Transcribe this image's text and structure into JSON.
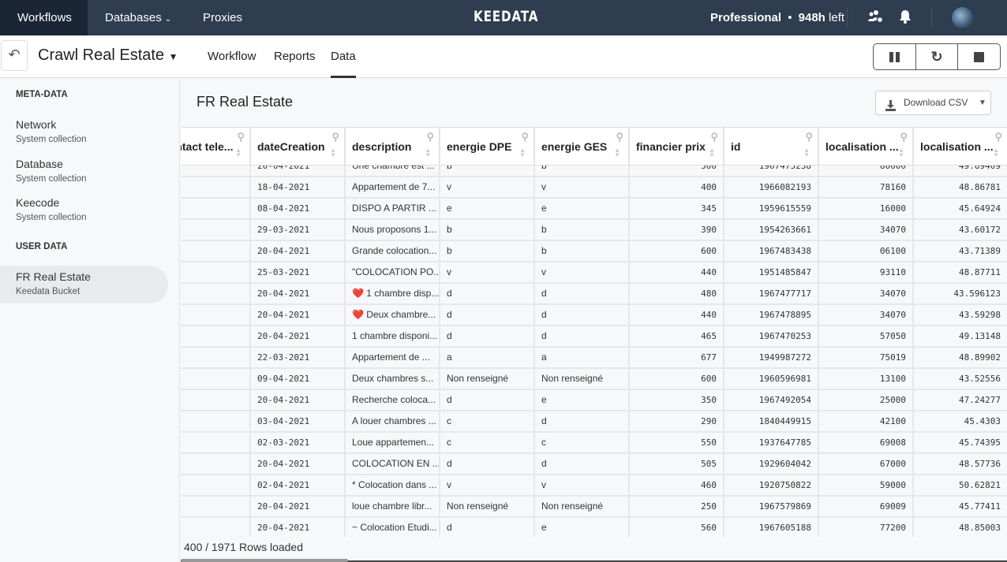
{
  "topnav": {
    "items": [
      "Workflows",
      "Databases",
      "Proxies"
    ],
    "logo": "KEEDATA",
    "plan": "Professional",
    "bullet": "•",
    "hours": "948h",
    "left": "left"
  },
  "subheader": {
    "title": "Crawl Real Estate",
    "tabs": [
      "Workflow",
      "Reports",
      "Data"
    ],
    "active_tab": "Data"
  },
  "sidebar": {
    "meta_label": "META-DATA",
    "meta_items": [
      {
        "name": "Network",
        "sub": "System collection"
      },
      {
        "name": "Database",
        "sub": "System collection"
      },
      {
        "name": "Keecode",
        "sub": "System collection"
      }
    ],
    "user_label": "USER DATA",
    "user_items": [
      {
        "name": "FR Real Estate",
        "sub": "Keedata Bucket"
      }
    ]
  },
  "main": {
    "title": "FR Real Estate",
    "download_label": "Download CSV"
  },
  "table": {
    "columns": [
      "contact tele...",
      "dateCreation",
      "description",
      "energie DPE",
      "energie GES",
      "financier prix",
      "id",
      "localisation ...",
      "localisation ..."
    ],
    "rows": [
      [
        "",
        "20-04-2021",
        "Une chambre est ...",
        "b",
        "b",
        "500",
        "1967475238",
        "80000",
        "49.89409"
      ],
      [
        "",
        "18-04-2021",
        "Appartement de 7...",
        "v",
        "v",
        "400",
        "1966082193",
        "78160",
        "48.86781"
      ],
      [
        "",
        "08-04-2021",
        "DISPO A PARTIR ...",
        "e",
        "e",
        "345",
        "1959615559",
        "16000",
        "45.64924"
      ],
      [
        "",
        "29-03-2021",
        "Nous proposons 1...",
        "b",
        "b",
        "390",
        "1954263661",
        "34070",
        "43.60172"
      ],
      [
        "",
        "20-04-2021",
        "Grande colocation...",
        "b",
        "b",
        "600",
        "1967483438",
        "06100",
        "43.71389"
      ],
      [
        "",
        "25-03-2021",
        "\"COLOCATION PO...",
        "v",
        "v",
        "440",
        "1951485847",
        "93110",
        "48.87711"
      ],
      [
        "",
        "20-04-2021",
        "❤️ 1 chambre disp...",
        "d",
        "d",
        "480",
        "1967477717",
        "34070",
        "43.596123"
      ],
      [
        "",
        "20-04-2021",
        "❤️ Deux chambre...",
        "d",
        "d",
        "440",
        "1967478895",
        "34070",
        "43.59298"
      ],
      [
        "",
        "20-04-2021",
        "1 chambre disponi...",
        "d",
        "d",
        "465",
        "1967470253",
        "57050",
        "49.13148"
      ],
      [
        "",
        "22-03-2021",
        "Appartement de ...",
        "a",
        "a",
        "677",
        "1949987272",
        "75019",
        "48.89902"
      ],
      [
        "",
        "09-04-2021",
        "Deux chambres s...",
        "Non renseigné",
        "Non renseigné",
        "600",
        "1960596981",
        "13100",
        "43.52556"
      ],
      [
        "",
        "20-04-2021",
        "Recherche coloca...",
        "d",
        "e",
        "350",
        "1967492054",
        "25000",
        "47.24277"
      ],
      [
        "",
        "03-04-2021",
        "A louer chambres ...",
        "c",
        "d",
        "290",
        "1840449915",
        "42100",
        "45.4303"
      ],
      [
        "",
        "02-03-2021",
        "Loue appartemen...",
        "c",
        "c",
        "550",
        "1937647785",
        "69008",
        "45.74395"
      ],
      [
        "",
        "20-04-2021",
        "COLOCATION EN ...",
        "d",
        "d",
        "505",
        "1929604042",
        "67000",
        "48.57736"
      ],
      [
        "",
        "02-04-2021",
        "* Colocation dans ...",
        "v",
        "v",
        "460",
        "1920750822",
        "59000",
        "50.62821"
      ],
      [
        "",
        "20-04-2021",
        "loue chambre libr...",
        "Non renseigné",
        "Non renseigné",
        "250",
        "1967579869",
        "69009",
        "45.77411"
      ],
      [
        "",
        "20-04-2021",
        "~ Colocation Etudi...",
        "d",
        "e",
        "560",
        "1967605188",
        "77200",
        "48.85003"
      ]
    ]
  },
  "footer": {
    "rows_loaded": "400 / 1971 Rows loaded"
  }
}
